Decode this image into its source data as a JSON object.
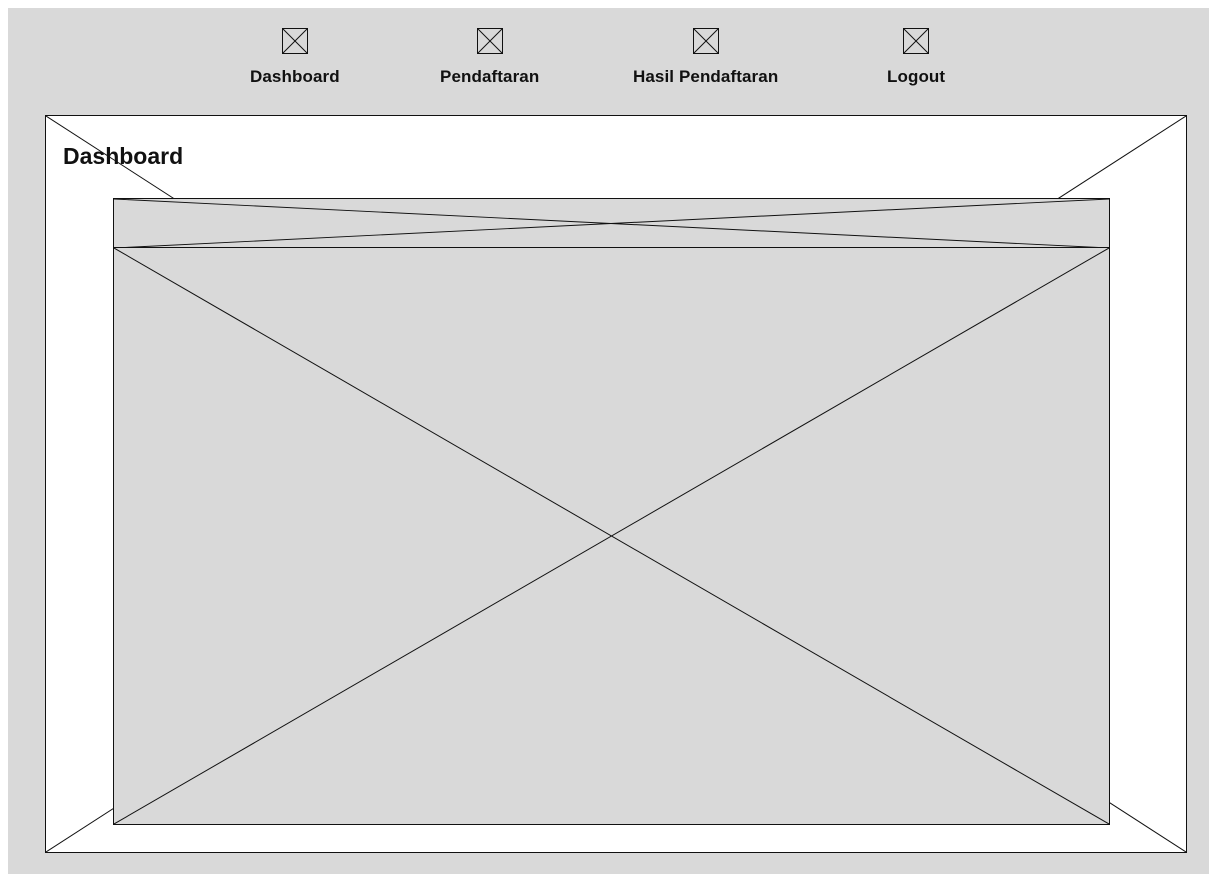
{
  "nav": {
    "items": [
      {
        "label": "Dashboard",
        "icon": "image-placeholder-icon"
      },
      {
        "label": "Pendaftaran",
        "icon": "image-placeholder-icon"
      },
      {
        "label": "Hasil Pendaftaran",
        "icon": "image-placeholder-icon"
      },
      {
        "label": "Logout",
        "icon": "image-placeholder-icon"
      }
    ]
  },
  "main": {
    "title": "Dashboard"
  },
  "colors": {
    "background": "#d9d9d9",
    "panel": "#ffffff",
    "stroke": "#111111"
  }
}
